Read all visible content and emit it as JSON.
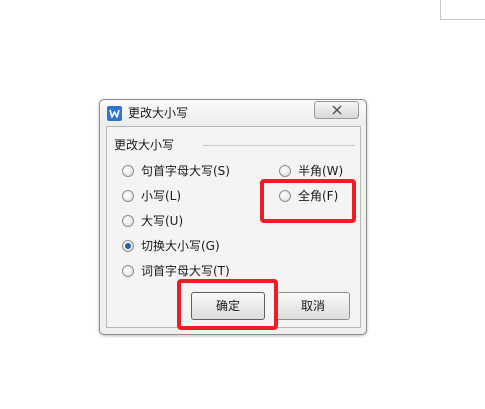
{
  "dialog": {
    "title": "更改大小写",
    "close_icon": "close-icon",
    "app_icon": "wps-writer-icon"
  },
  "group": {
    "label": "更改大小写"
  },
  "options": {
    "sentence_case": {
      "label": "句首字母大写(S)",
      "checked": false
    },
    "lower_case": {
      "label": "小写(L)",
      "checked": false
    },
    "upper_case": {
      "label": "大写(U)",
      "checked": false
    },
    "toggle_case": {
      "label": "切换大小写(G)",
      "checked": true
    },
    "title_case": {
      "label": "词首字母大写(T)",
      "checked": false
    },
    "half_width": {
      "label": "半角(W)",
      "checked": false
    },
    "full_width": {
      "label": "全角(F)",
      "checked": false
    }
  },
  "buttons": {
    "ok_label": "确定",
    "cancel_label": "取消"
  },
  "colors": {
    "highlight": "#ee1c24",
    "app_icon": "#2f74d0",
    "radio_selected": "#1f5fb8"
  }
}
